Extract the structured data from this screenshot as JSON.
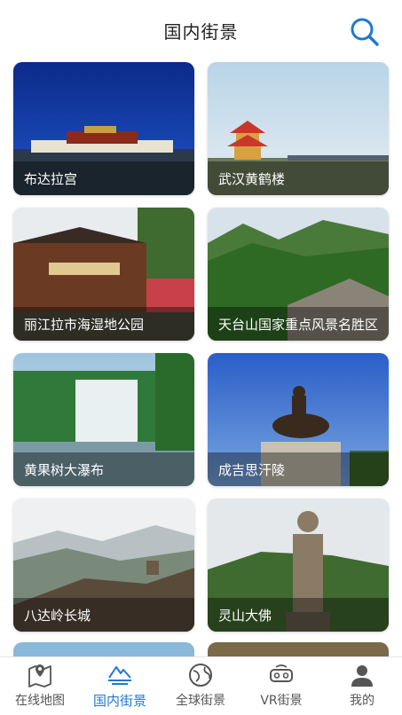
{
  "header": {
    "title": "国内街景"
  },
  "cards": [
    {
      "label": "布达拉宫"
    },
    {
      "label": "武汉黄鹤楼"
    },
    {
      "label": "丽江拉市海湿地公园"
    },
    {
      "label": "天台山国家重点风景名胜区"
    },
    {
      "label": "黄果树大瀑布"
    },
    {
      "label": "成吉思汗陵"
    },
    {
      "label": "八达岭长城"
    },
    {
      "label": "灵山大佛"
    }
  ],
  "tabs": [
    {
      "label": "在线地图",
      "icon": "map-pin-icon"
    },
    {
      "label": "国内街景",
      "icon": "mountain-icon",
      "active": true
    },
    {
      "label": "全球街景",
      "icon": "globe-icon"
    },
    {
      "label": "VR街景",
      "icon": "vr-headset-icon"
    },
    {
      "label": "我的",
      "icon": "person-icon"
    }
  ],
  "colors": {
    "accent": "#1e78d6",
    "tab_text": "#555555"
  }
}
